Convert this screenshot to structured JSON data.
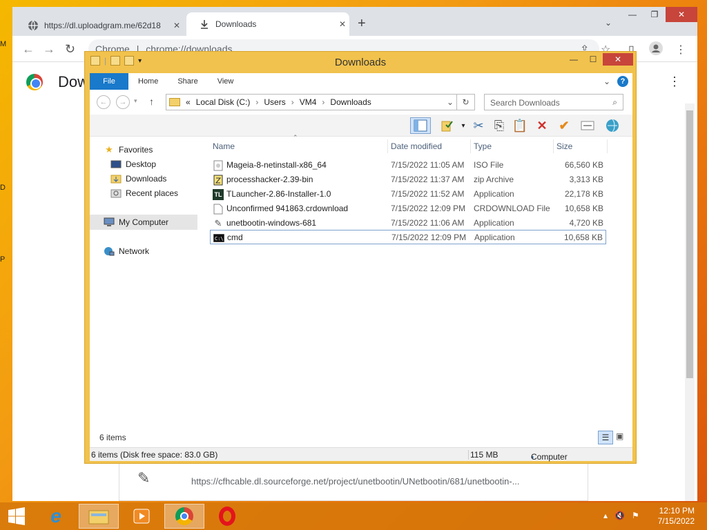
{
  "browser": {
    "tabs": [
      {
        "label": "https://dl.uploadgram.me/62d18",
        "close": "✕"
      },
      {
        "label": "Downloads",
        "close": "✕"
      }
    ],
    "new_tab": "+",
    "omnibox_prefix": "Chrome",
    "omnibox_url": "chrome://downloads",
    "page_title": "Dow",
    "download_url": "https://cfhcable.dl.sourceforge.net/project/unetbootin/UNetbootin/681/unetbootin-..."
  },
  "explorer": {
    "title": "Downloads",
    "ribbon_tabs": [
      "File",
      "Home",
      "Share",
      "View"
    ],
    "breadcrumb": [
      "«",
      "Local Disk (C:)",
      "Users",
      "VM4",
      "Downloads"
    ],
    "search_placeholder": "Search Downloads",
    "columns": {
      "name": "Name",
      "date": "Date modified",
      "type": "Type",
      "size": "Size"
    },
    "nav": {
      "favorites": "Favorites",
      "desktop": "Desktop",
      "downloads": "Downloads",
      "recent": "Recent places",
      "computer": "My Computer",
      "network": "Network"
    },
    "files": [
      {
        "name": "Mageia-8-netinstall-x86_64",
        "date": "7/15/2022 11:05 AM",
        "type": "ISO File",
        "size": "66,560 KB",
        "icon": "iso-file-icon"
      },
      {
        "name": "processhacker-2.39-bin",
        "date": "7/15/2022 11:37 AM",
        "type": "zip Archive",
        "size": "3,313 KB",
        "icon": "zip-file-icon"
      },
      {
        "name": "TLauncher-2.86-Installer-1.0",
        "date": "7/15/2022 11:52 AM",
        "type": "Application",
        "size": "22,178 KB",
        "icon": "tlauncher-icon"
      },
      {
        "name": "Unconfirmed 941863.crdownload",
        "date": "7/15/2022 12:09 PM",
        "type": "CRDOWNLOAD File",
        "size": "10,658 KB",
        "icon": "blank-file-icon"
      },
      {
        "name": "unetbootin-windows-681",
        "date": "7/15/2022 11:06 AM",
        "type": "Application",
        "size": "4,720 KB",
        "icon": "unetbootin-icon"
      },
      {
        "name": "cmd",
        "date": "7/15/2022 12:09 PM",
        "type": "Application",
        "size": "10,658 KB",
        "icon": "cmd-icon"
      }
    ],
    "item_count": "6 items",
    "status_left": "6 items (Disk free space: 83.0 GB)",
    "status_size": "115 MB",
    "status_location": "Computer"
  },
  "taskbar": {
    "time": "12:10 PM",
    "date": "7/15/2022"
  }
}
